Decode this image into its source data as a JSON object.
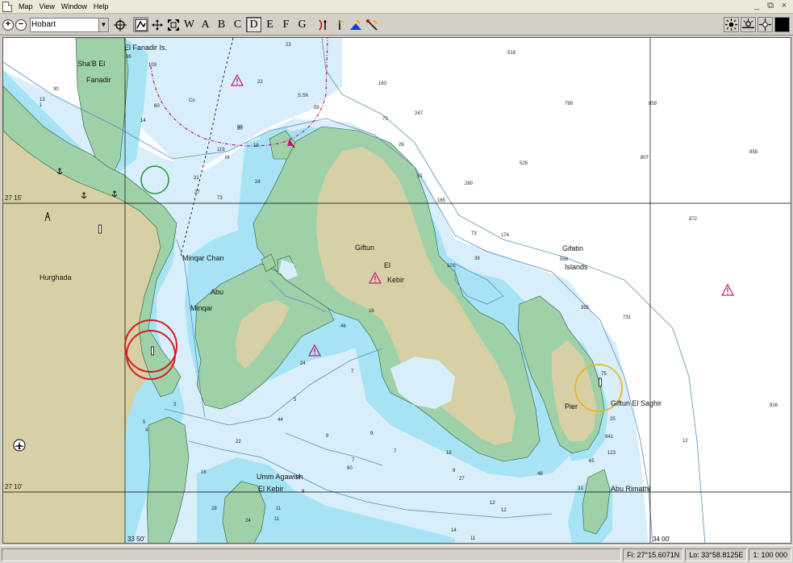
{
  "menu": {
    "items": [
      "Map",
      "View",
      "Window",
      "Help"
    ],
    "win_controls": [
      "_",
      "⧉",
      "×"
    ]
  },
  "toolbar": {
    "zoom_in": "+",
    "zoom_out": "−",
    "location_value": "Hobart",
    "letters": [
      "A",
      "B",
      "C",
      "D",
      "E",
      "F",
      "G"
    ],
    "pressed_letter": "D",
    "letter_w": "W"
  },
  "chart": {
    "colors": {
      "land": "#d6d0a4",
      "drying": "#9fd1a9",
      "shallow": "#a6e4f5",
      "mid": "#d8eefb",
      "deep": "#ffffff",
      "contour": "#5a8fb8",
      "grid": "#000000",
      "magenta": "#c0208a",
      "red_circle": "#d42020",
      "green_circle": "#1a9a2a",
      "yellow_circle": "#e8b820"
    },
    "place_names": [
      {
        "text": "El Fanadir Is."
      },
      {
        "text": "Sha'B El"
      },
      {
        "text": "Fanadir"
      },
      {
        "text": "Hurghada"
      },
      {
        "text": "Minqar Chan"
      },
      {
        "text": "Abu"
      },
      {
        "text": "Minqar"
      },
      {
        "text": "Giftun"
      },
      {
        "text": "El"
      },
      {
        "text": "Kebir"
      },
      {
        "text": "Gifatin"
      },
      {
        "text": "Islands"
      },
      {
        "text": "Pier"
      },
      {
        "text": "Giftun El Saghir"
      },
      {
        "text": "Umm Agawish"
      },
      {
        "text": "El Kebir"
      },
      {
        "text": "Abu Rimathi"
      }
    ],
    "lat_labels": [
      "27 15'",
      "27 10'"
    ],
    "lon_labels": [
      "33 50'",
      "34 00'"
    ],
    "depths": [
      "23",
      "518",
      "96",
      "103",
      "22",
      "S.Sh",
      "183",
      "799",
      "859",
      "30",
      "13",
      "1",
      "60",
      "Co",
      "80",
      "59",
      "73",
      "247",
      "14",
      "90",
      "119",
      "M",
      "18",
      "26",
      "529",
      "807",
      "858",
      "24",
      "51",
      "31",
      "27",
      "73",
      "165",
      "280",
      "872",
      "174",
      "73",
      "101",
      "39",
      "558",
      "355",
      "731",
      "16",
      "46",
      "24",
      "7",
      "5",
      "44",
      "9",
      "7",
      "22",
      "9",
      "7",
      "16",
      "18",
      "9",
      "123",
      "27",
      "48",
      "31",
      "65",
      "12",
      "12",
      "9",
      "19",
      "11",
      "11",
      "28",
      "24",
      "11",
      "14",
      "90",
      "75",
      "25",
      "841",
      "916",
      "12",
      "5",
      "4",
      "3"
    ]
  },
  "status": {
    "position": "Fi: 27°15.6071N",
    "longitude": "Lo: 33°58.8125E",
    "scale": "1: 100 000"
  }
}
